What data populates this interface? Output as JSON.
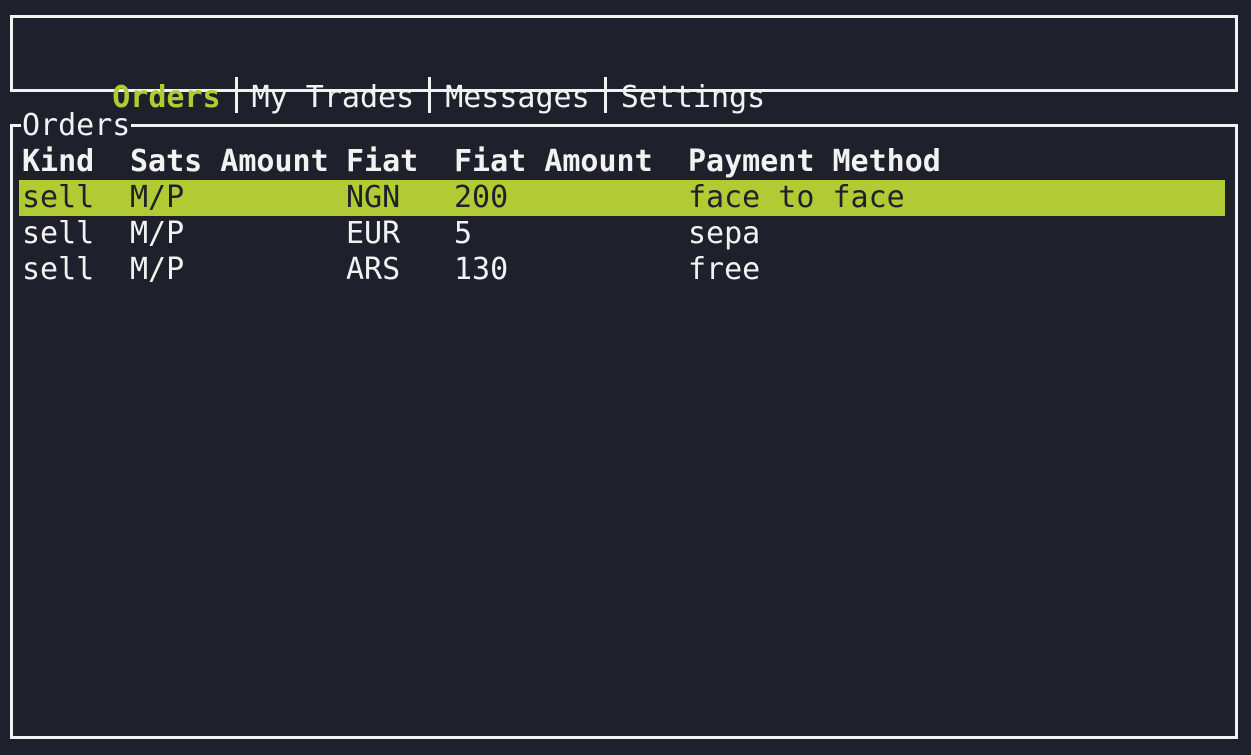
{
  "tabs": [
    {
      "label": "Orders",
      "active": true
    },
    {
      "label": "My Trades",
      "active": false
    },
    {
      "label": "Messages",
      "active": false
    },
    {
      "label": "Settings",
      "active": false
    }
  ],
  "panel": {
    "title": "Orders",
    "columns": [
      "Kind",
      "Sats Amount",
      "Fiat",
      "Fiat Amount",
      "Payment Method"
    ],
    "rows": [
      {
        "kind": "sell",
        "sats_amount": "M/P",
        "fiat": "NGN",
        "fiat_amount": "200",
        "payment_method": "face to face",
        "selected": true
      },
      {
        "kind": "sell",
        "sats_amount": "M/P",
        "fiat": "EUR",
        "fiat_amount": "5",
        "payment_method": "sepa",
        "selected": false
      },
      {
        "kind": "sell",
        "sats_amount": "M/P",
        "fiat": "ARS",
        "fiat_amount": "130",
        "payment_method": "free",
        "selected": false
      }
    ]
  },
  "colors": {
    "background": "#1e212b",
    "foreground": "#f2f2f2",
    "accent": "#b2cb34"
  }
}
